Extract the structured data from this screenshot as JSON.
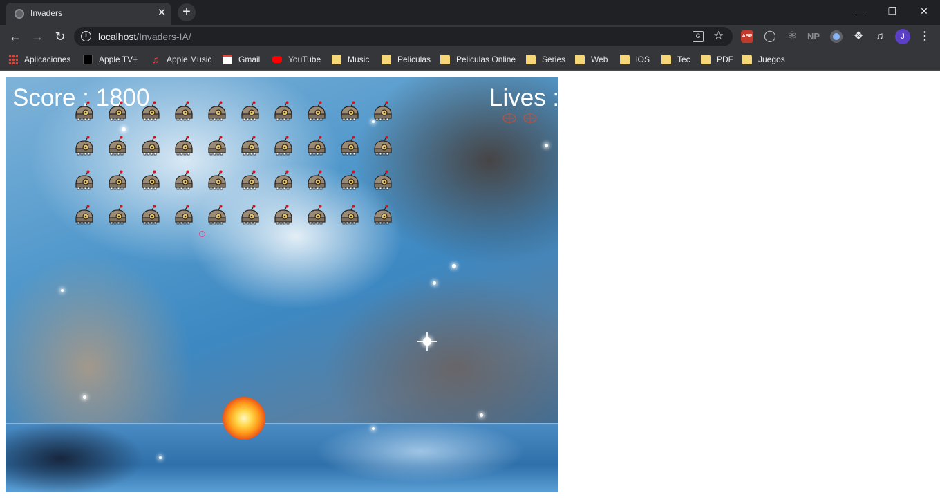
{
  "browser": {
    "tab_title": "Invaders",
    "tab_close": "✕",
    "new_tab": "+",
    "window_controls": {
      "minimize": "—",
      "restore": "❐",
      "close": "✕"
    },
    "url_host": "localhost",
    "url_path": "/Invaders-IA/",
    "extensions": {
      "abp": "ABP",
      "np": "NP"
    },
    "avatar_letter": "J",
    "bookmarks": [
      {
        "label": "Aplicaciones",
        "icon": "apps-grid-icon"
      },
      {
        "label": "Apple TV+",
        "icon": "apple-tv-icon"
      },
      {
        "label": "Apple Music",
        "icon": "apple-music-icon"
      },
      {
        "label": "Gmail",
        "icon": "gmail-icon"
      },
      {
        "label": "YouTube",
        "icon": "youtube-icon"
      },
      {
        "label": "Music",
        "icon": "folder-icon"
      },
      {
        "label": "Peliculas",
        "icon": "folder-icon"
      },
      {
        "label": "Peliculas Online",
        "icon": "folder-icon"
      },
      {
        "label": "Series",
        "icon": "folder-icon"
      },
      {
        "label": "Web",
        "icon": "folder-icon"
      },
      {
        "label": "iOS",
        "icon": "folder-icon"
      },
      {
        "label": "Tec",
        "icon": "folder-icon"
      },
      {
        "label": "PDF",
        "icon": "folder-icon"
      },
      {
        "label": "Juegos",
        "icon": "folder-icon"
      }
    ]
  },
  "game": {
    "score_text": "Score : 1800",
    "lives_text": "Lives :",
    "lives_remaining": 2,
    "invader_rows": 4,
    "invader_cols": 10,
    "colors": {
      "hud_text": "#ffffff",
      "bullet": "#e0437c"
    }
  }
}
